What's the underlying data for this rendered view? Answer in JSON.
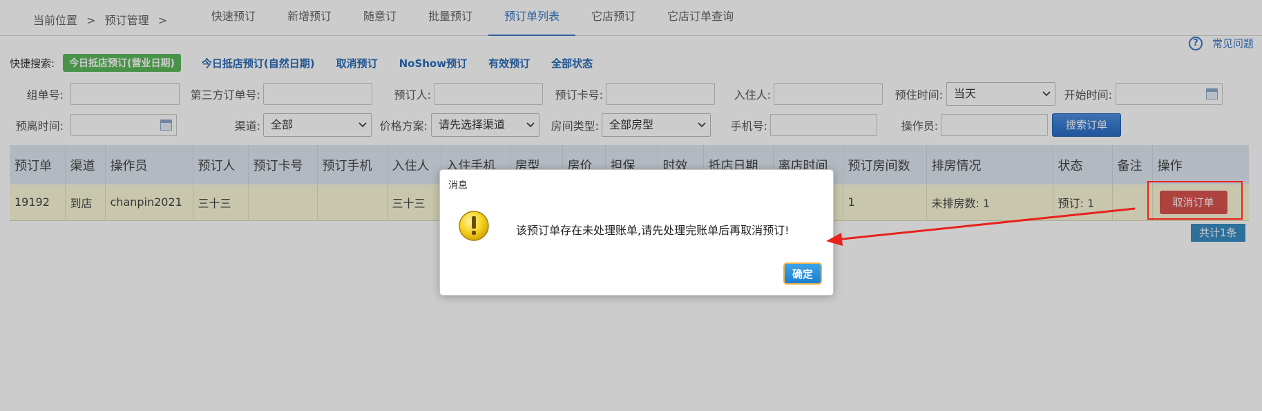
{
  "breadcrumb": {
    "items": [
      "当前位置",
      ">",
      "预订管理",
      ">"
    ]
  },
  "tabs": [
    "快速预订",
    "新增预订",
    "随意订",
    "批量预订",
    "预订单列表",
    "它店预订",
    "它店订单查询"
  ],
  "active_tab": "预订单列表",
  "help": {
    "icon": "?",
    "label": "常见问题"
  },
  "quick_search": {
    "label": "快捷搜索:",
    "active": "今日抵店预订(营业日期)",
    "links": [
      "今日抵店预订(自然日期)",
      "取消预订",
      "NoShow预订",
      "有效预订",
      "全部状态"
    ]
  },
  "form": {
    "group_no": {
      "label": "组单号:",
      "value": ""
    },
    "third_party_no": {
      "label": "第三方订单号:",
      "value": ""
    },
    "booker": {
      "label": "预订人:",
      "value": ""
    },
    "booking_card": {
      "label": "预订卡号:",
      "value": ""
    },
    "guest": {
      "label": "入住人:",
      "value": ""
    },
    "checkin_time": {
      "label": "预住时间:",
      "value": "当天"
    },
    "start_time": {
      "label": "开始时间:",
      "value": ""
    },
    "departure_time": {
      "label": "预离时间:",
      "value": ""
    },
    "channel": {
      "label": "渠道:",
      "value": "全部"
    },
    "price_plan": {
      "label": "价格方案:",
      "value": "请先选择渠道"
    },
    "room_type": {
      "label": "房间类型:",
      "value": "全部房型"
    },
    "phone": {
      "label": "手机号:",
      "value": ""
    },
    "operator": {
      "label": "操作员:",
      "value": ""
    },
    "search_button": "搜索订单"
  },
  "table": {
    "headers": [
      "预订单",
      "渠道",
      "操作员",
      "预订人",
      "预订卡号",
      "预订手机",
      "入住人",
      "入住手机",
      "房型",
      "房价",
      "担保",
      "时效",
      "抵店日期",
      "离店时间",
      "预订房间数",
      "排房情况",
      "状态",
      "备注",
      "操作"
    ],
    "rows": [
      {
        "order": "19192",
        "channel": "到店",
        "operator": "chanpin2021",
        "booker": "三十三",
        "card": "",
        "phone": "",
        "guest": "三十三",
        "rooms": "1",
        "arrange": "未排房数: 1",
        "status": "预订: 1",
        "remark": "",
        "action": "取消订单"
      }
    ],
    "total": "共计1条"
  },
  "dialog": {
    "title": "消息",
    "message": "该预订单存在未处理账单,请先处理完账单后再取消预订!",
    "ok": "确定"
  },
  "colors": {
    "accent": "#3a79c4",
    "danger": "#d9534f",
    "success": "#5cb85c",
    "annotation": "#e8211a"
  }
}
